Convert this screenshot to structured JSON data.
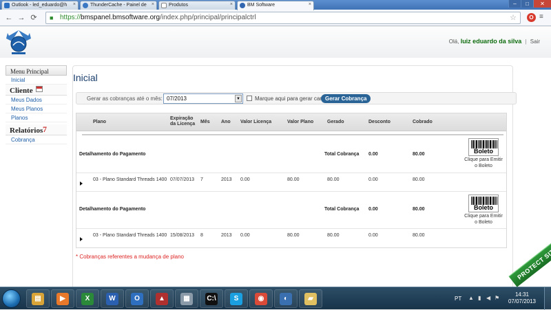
{
  "browser": {
    "tabs": [
      {
        "label": "Outlook - led_eduardo@h",
        "color": "#2b6fc2"
      },
      {
        "label": "ThunderCache - Painel de",
        "color": "#3b78c4"
      },
      {
        "label": "Produtos",
        "color": "#888888"
      },
      {
        "label": "BM Software",
        "color": "#3266b0"
      }
    ],
    "url": {
      "scheme": "https://",
      "host": "bmspanel.bmsoftware.org",
      "path": "/index.php/principal/principalctrl"
    }
  },
  "header": {
    "greeting": "Olá,",
    "username": "luiz eduardo da silva",
    "separator": "|",
    "logout": "Sair"
  },
  "sidebar": {
    "menu_title": "Menu Principal",
    "home": "Inicial",
    "client_title": "Cliente",
    "client_items": [
      "Meus Dados",
      "Meus Planos",
      "Planos"
    ],
    "reports_title": "Relatórios",
    "reports_items": [
      "Cobrança"
    ]
  },
  "main": {
    "title": "Inicial",
    "filter": {
      "label": "Gerar as cobranças até o mês:",
      "month": "07/2013",
      "carne_label": "Marque aqui para gerar carnê",
      "button": "Gerar Cobrança"
    },
    "table": {
      "columns": {
        "plano": "Plano",
        "expiracao_1": "Expiração",
        "expiracao_2": "da Licença",
        "mes": "Mês",
        "ano": "Ano",
        "valor_licenca": "Valor Licença",
        "valor_plano": "Valor Plano",
        "gerado": "Gerado",
        "desconto": "Desconto",
        "cobrado": "Cobrado"
      },
      "detail_label": "Detalhamento do Pagamento",
      "total_label": "Total Cobrança",
      "boleto_label": "Boleto",
      "emit_label": "Clique para Emitir o Boleto",
      "payments": [
        {
          "total_desconto": "0.00",
          "total_cobrado": "80.00",
          "row": {
            "plano": "03 - Plano Standard Threads 1400",
            "expiracao": "07/07/2013",
            "mes": "7",
            "ano": "2013",
            "valor_licenca": "0.00",
            "valor_plano": "80.00",
            "gerado": "80.00",
            "desconto": "0.00",
            "cobrado": "80.00"
          }
        },
        {
          "total_desconto": "0.00",
          "total_cobrado": "80.00",
          "row": {
            "plano": "03 - Plano Standard Threads 1400",
            "expiracao": "15/08/2013",
            "mes": "8",
            "ano": "2013",
            "valor_licenca": "0.00",
            "valor_plano": "80.00",
            "gerado": "80.00",
            "desconto": "0.00",
            "cobrado": "80.00"
          }
        }
      ]
    },
    "footnote": "* Cobranças referentes a mudança de plano"
  },
  "taskbar": {
    "lang": "PT",
    "time": "14:31",
    "date": "07/07/2013",
    "apps": [
      {
        "name": "file-explorer-icon",
        "glyph": "▤",
        "color": "#d8a437"
      },
      {
        "name": "media-player-icon",
        "glyph": "▶",
        "color": "#e8782a"
      },
      {
        "name": "excel-icon",
        "glyph": "X",
        "color": "#2a8a3a"
      },
      {
        "name": "word-icon",
        "glyph": "W",
        "color": "#2b5fb0"
      },
      {
        "name": "outlook-icon",
        "glyph": "O",
        "color": "#2f6fc0"
      },
      {
        "name": "access-icon",
        "glyph": "▲",
        "color": "#b03030"
      },
      {
        "name": "calculator-icon",
        "glyph": "▦",
        "color": "#8a9aa8"
      },
      {
        "name": "terminal-icon",
        "glyph": "C:\\",
        "color": "#111111"
      },
      {
        "name": "skype-icon",
        "glyph": "S",
        "color": "#1aa0e0"
      },
      {
        "name": "chrome-icon",
        "glyph": "◉",
        "color": "#d94a38"
      },
      {
        "name": "remote-icon",
        "glyph": "◐",
        "color": "#3a6fb0"
      },
      {
        "name": "folder-icon",
        "glyph": "▰",
        "color": "#e0c060"
      }
    ]
  },
  "watermark": "PROTECT SITE"
}
